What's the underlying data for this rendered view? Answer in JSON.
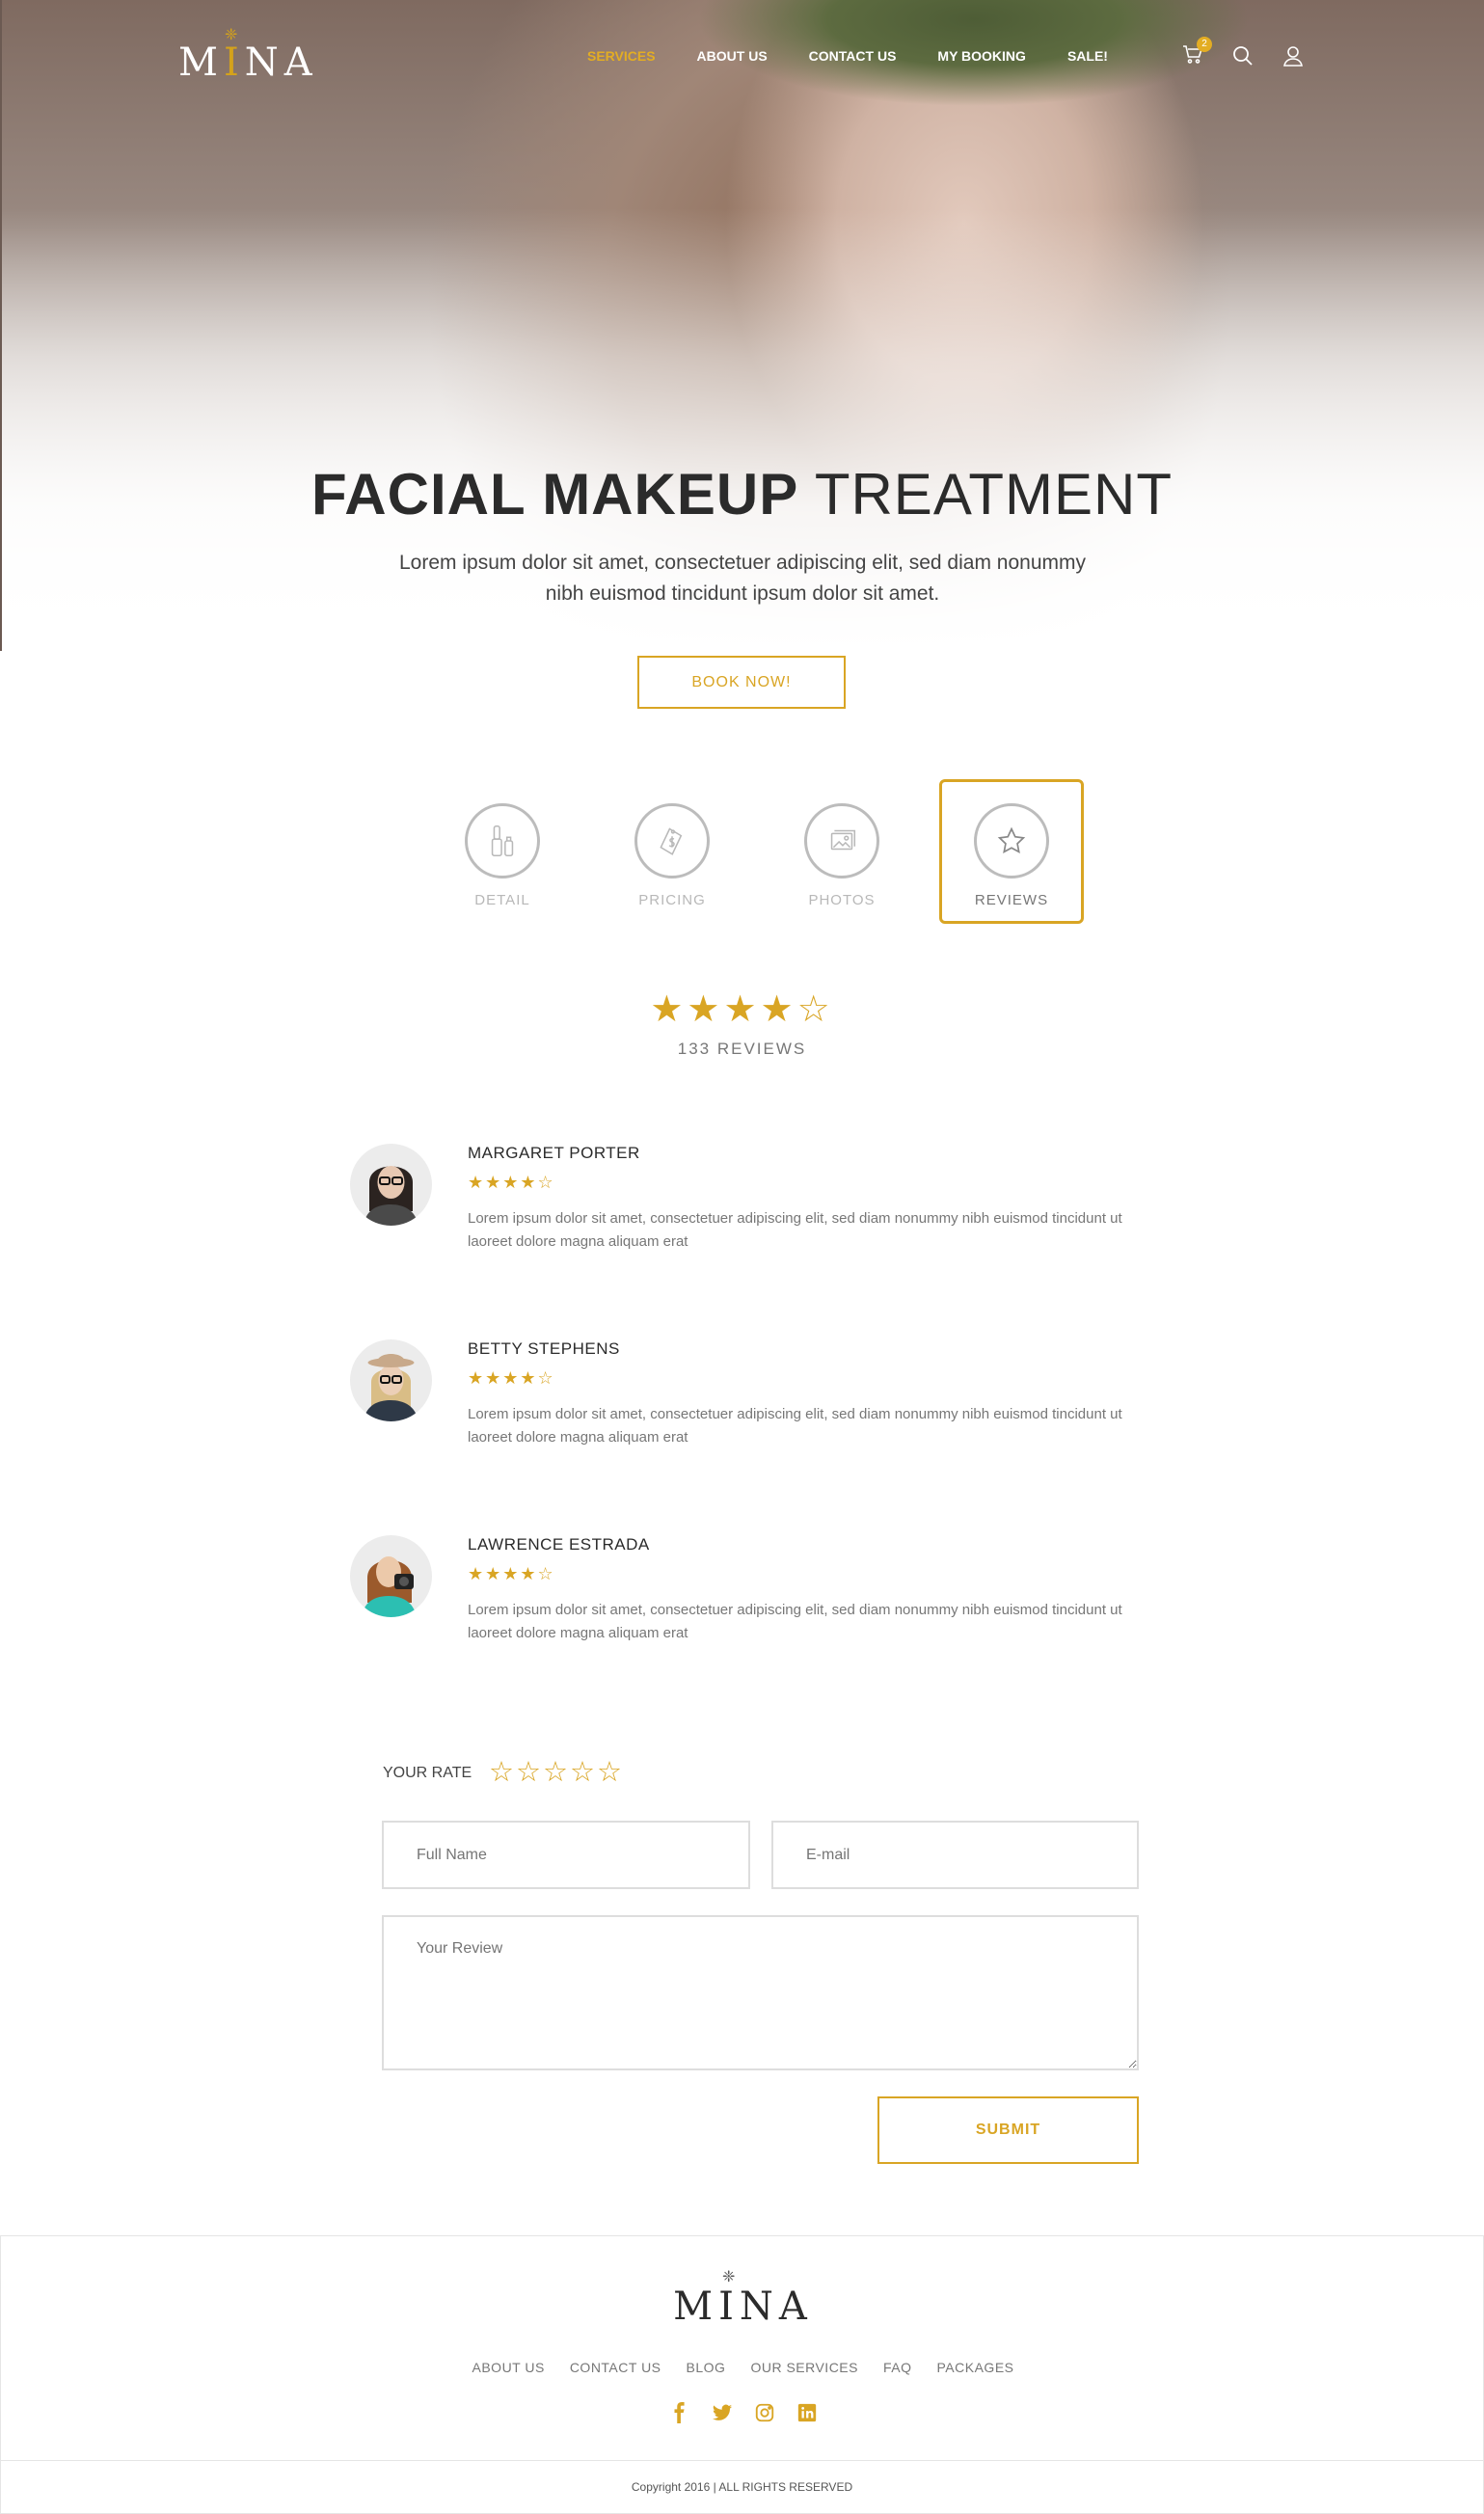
{
  "brand": {
    "name_before": "M",
    "name_accent": "I",
    "name_after": "NA",
    "accent_color": "#d9a524"
  },
  "nav": {
    "items": [
      {
        "label": "SERVICES",
        "active": true
      },
      {
        "label": "ABOUT US",
        "active": false
      },
      {
        "label": "CONTACT US",
        "active": false
      },
      {
        "label": "MY BOOKING",
        "active": false
      },
      {
        "label": "SALE!",
        "active": false
      }
    ],
    "cart_count": "2",
    "icons": [
      "cart-icon",
      "search-icon",
      "user-icon"
    ]
  },
  "hero": {
    "title_bold": "FACIAL MAKEUP",
    "title_light": "TREATMENT",
    "subtitle": "Lorem ipsum dolor sit amet, consectetuer adipiscing elit, sed diam nonummy nibh euismod tincidunt ipsum dolor sit amet.",
    "cta_label": "BOOK NOW!"
  },
  "tabs": [
    {
      "label": "DETAIL",
      "icon": "makeup-icon",
      "active": false
    },
    {
      "label": "PRICING",
      "icon": "price-tag-icon",
      "active": false
    },
    {
      "label": "PHOTOS",
      "icon": "photos-icon",
      "active": false
    },
    {
      "label": "REVIEWS",
      "icon": "star-icon",
      "active": true
    }
  ],
  "summary": {
    "stars": "★★★★☆",
    "rating": 4,
    "count_label": "133 REVIEWS"
  },
  "reviews": [
    {
      "name": "MARGARET PORTER",
      "rating": 4,
      "stars": "★★★★☆",
      "text": "Lorem ipsum dolor sit amet, consectetuer adipiscing elit, sed diam nonummy nibh euismod tincidunt ut laoreet dolore magna aliquam erat"
    },
    {
      "name": "BETTY STEPHENS",
      "rating": 4,
      "stars": "★★★★☆",
      "text": "Lorem ipsum dolor sit amet, consectetuer adipiscing elit, sed diam nonummy nibh euismod tincidunt ut laoreet dolore magna aliquam erat"
    },
    {
      "name": "LAWRENCE ESTRADA",
      "rating": 4,
      "stars": "★★★★☆",
      "text": "Lorem ipsum dolor sit amet, consectetuer adipiscing elit, sed diam nonummy nibh euismod tincidunt ut laoreet dolore magna aliquam erat"
    }
  ],
  "form": {
    "rate_label": "YOUR RATE",
    "rate_stars": "☆☆☆☆☆",
    "name_placeholder": "Full Name",
    "email_placeholder": "E-mail",
    "review_placeholder": "Your Review",
    "submit_label": "SUBMIT"
  },
  "footer": {
    "brand": "MINA",
    "links": [
      "ABOUT US",
      "CONTACT US",
      "BLOG",
      "OUR SERVICES",
      "FAQ",
      "PACKAGES"
    ],
    "social": [
      "facebook-icon",
      "twitter-icon",
      "instagram-icon",
      "linkedin-icon"
    ],
    "copyright": "Copyright 2016 | ALL RIGHTS RESERVED"
  }
}
